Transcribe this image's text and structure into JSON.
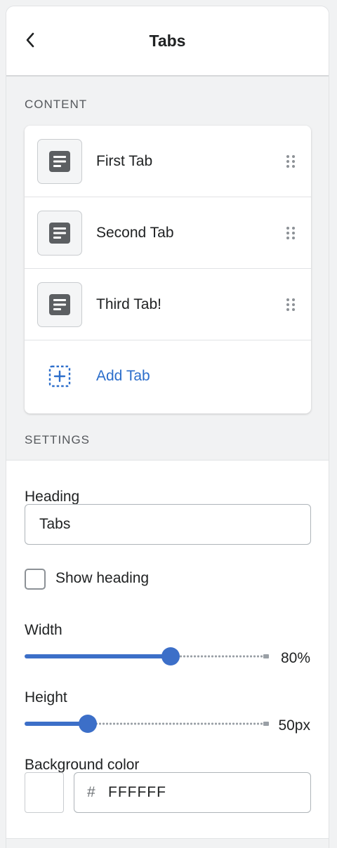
{
  "header": {
    "title": "Tabs",
    "back_icon": "chevron-left-icon"
  },
  "content": {
    "section_label": "CONTENT",
    "blocks": [
      {
        "label": "First Tab",
        "icon": "text-block-icon"
      },
      {
        "label": "Second Tab",
        "icon": "text-block-icon"
      },
      {
        "label": "Third Tab!",
        "icon": "text-block-icon"
      }
    ],
    "add_label": "Add Tab",
    "add_icon": "add-block-icon"
  },
  "settings": {
    "section_label": "SETTINGS",
    "heading": {
      "label": "Heading",
      "value": "Tabs"
    },
    "show_heading": {
      "label": "Show heading",
      "checked": false
    },
    "width": {
      "label": "Width",
      "value_text": "80%",
      "level": 0.6
    },
    "height": {
      "label": "Height",
      "value_text": "50px",
      "level": 0.26
    },
    "background_color": {
      "label": "Background color",
      "prefix": "#",
      "value": "FFFFFF",
      "swatch": "#FFFFFF"
    }
  },
  "colors": {
    "accent": "#3c6fc8",
    "link": "#2c6ecb"
  }
}
